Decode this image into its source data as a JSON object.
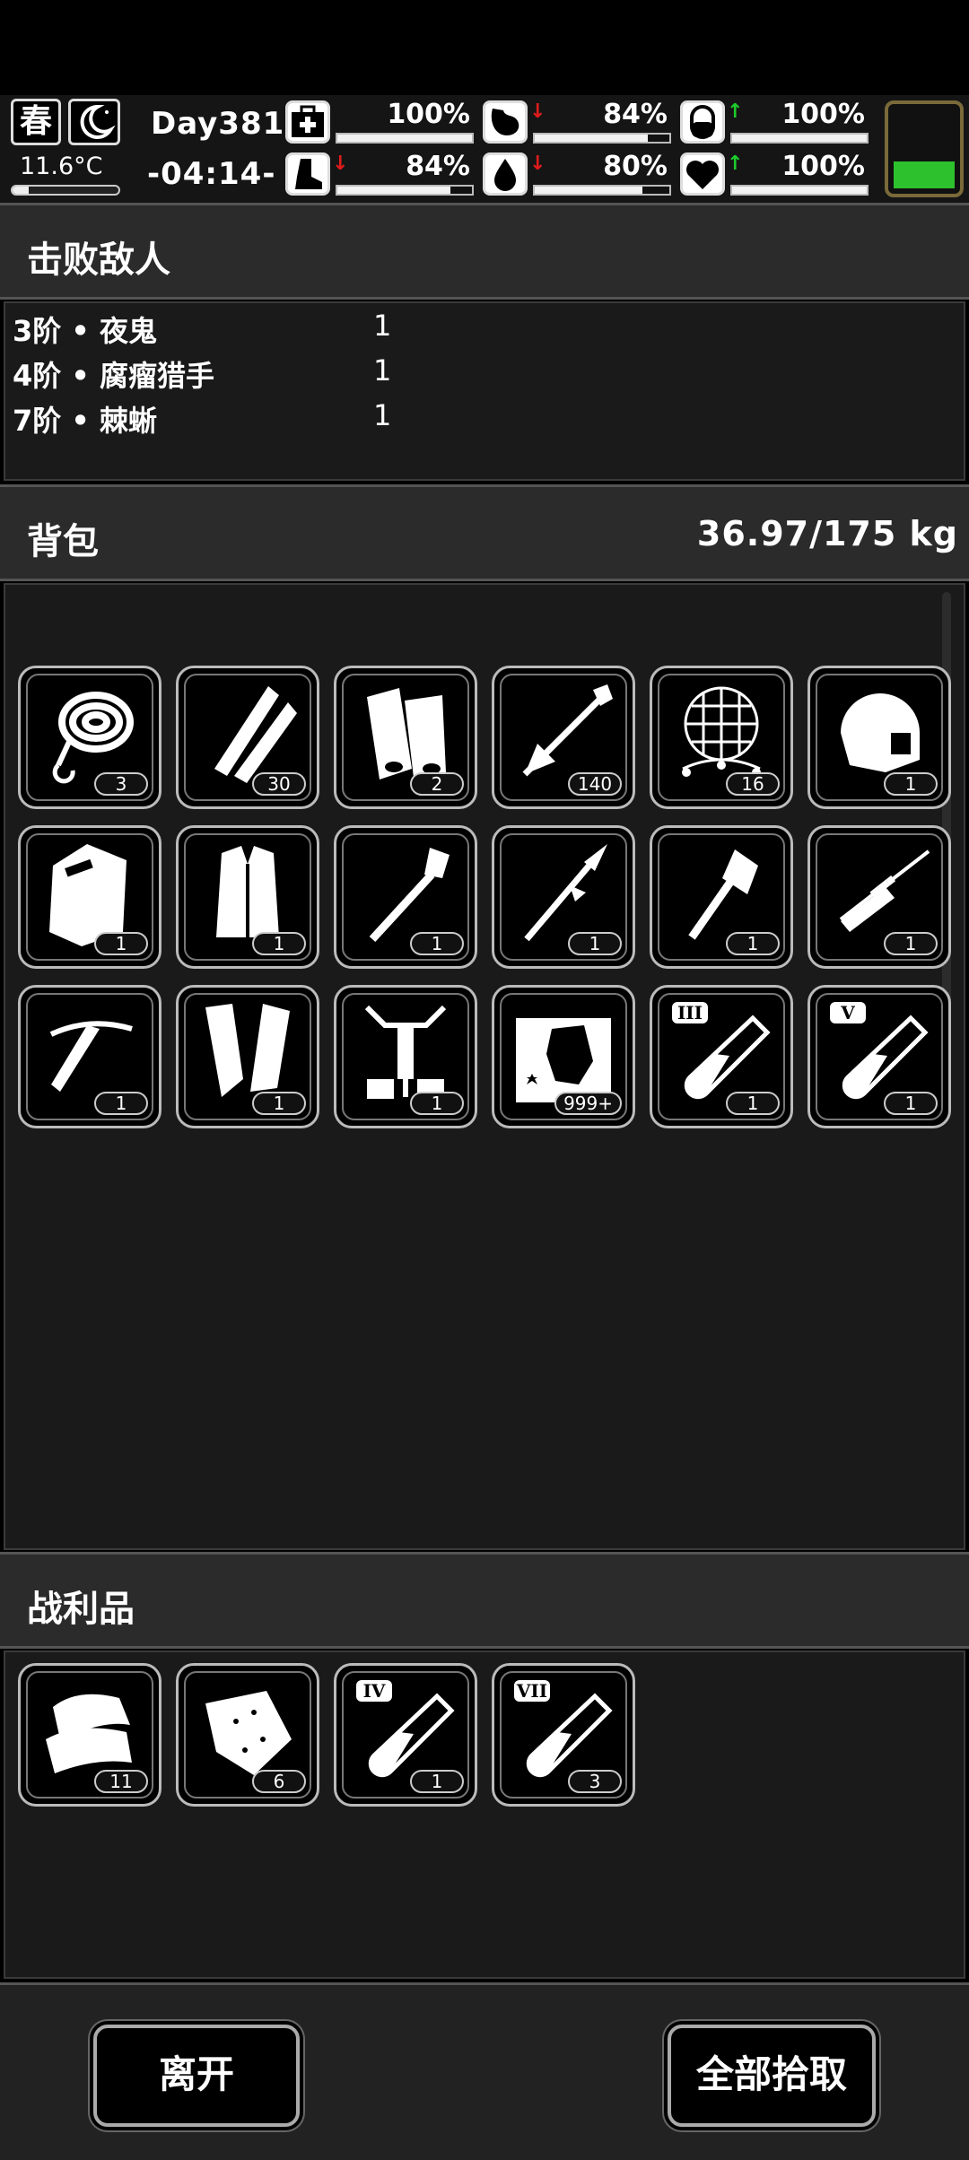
{
  "status": {
    "season": "春",
    "temperature": "11.6°C",
    "temperature_level": 0.15,
    "day": "Day381",
    "time": "-04:14-",
    "stats": [
      {
        "name": "health",
        "icon": "medkit-icon",
        "value": "100%",
        "level": 1.0,
        "trend": ""
      },
      {
        "name": "hunger",
        "icon": "stomach-icon",
        "value": "84%",
        "level": 0.84,
        "trend": "down"
      },
      {
        "name": "energy",
        "icon": "pill-icon",
        "value": "100%",
        "level": 1.0,
        "trend": "up"
      },
      {
        "name": "stamina",
        "icon": "boot-icon",
        "value": "84%",
        "level": 0.84,
        "trend": "down"
      },
      {
        "name": "thirst",
        "icon": "water-drop-icon",
        "value": "80%",
        "level": 0.8,
        "trend": "down"
      },
      {
        "name": "mood",
        "icon": "heart-icon",
        "value": "100%",
        "level": 1.0,
        "trend": "up"
      }
    ],
    "battery_level": 0.3
  },
  "defeated": {
    "title": "击败敌人",
    "enemies": [
      {
        "name": "3阶 • 夜鬼",
        "count": "1"
      },
      {
        "name": "4阶 • 腐瘤猎手",
        "count": "1"
      },
      {
        "name": "7阶 • 棘蜥",
        "count": "1"
      }
    ]
  },
  "backpack": {
    "title": "背包",
    "weight": "36.97/175 kg",
    "items": [
      {
        "icon": "rope-icon",
        "qty": "3"
      },
      {
        "icon": "bullets-icon",
        "qty": "30"
      },
      {
        "icon": "cloth-roll-icon",
        "qty": "2"
      },
      {
        "icon": "arrow-icon",
        "qty": "140"
      },
      {
        "icon": "net-icon",
        "qty": "16"
      },
      {
        "icon": "helmet-icon",
        "qty": "1"
      },
      {
        "icon": "riot-shield-icon",
        "qty": "1"
      },
      {
        "icon": "fur-coat-icon",
        "qty": "1"
      },
      {
        "icon": "shovel-icon",
        "qty": "1"
      },
      {
        "icon": "spear-icon",
        "qty": "1"
      },
      {
        "icon": "axe-icon",
        "qty": "1"
      },
      {
        "icon": "sniper-rifle-icon",
        "qty": "1"
      },
      {
        "icon": "crossbow-icon",
        "qty": "1"
      },
      {
        "icon": "arm-guards-icon",
        "qty": "1"
      },
      {
        "icon": "exoskeleton-icon",
        "qty": "1"
      },
      {
        "icon": "monster-card-icon",
        "qty": "999+"
      },
      {
        "icon": "test-tube-icon",
        "tier": "III",
        "qty": "1"
      },
      {
        "icon": "test-tube-icon",
        "tier": "V",
        "qty": "1"
      }
    ]
  },
  "loot": {
    "title": "战利品",
    "items": [
      {
        "icon": "leather-icon",
        "qty": "11"
      },
      {
        "icon": "raw-meat-icon",
        "qty": "6"
      },
      {
        "icon": "test-tube-icon",
        "tier": "IV",
        "qty": "1"
      },
      {
        "icon": "test-tube-icon",
        "tier": "VII",
        "qty": "3"
      }
    ]
  },
  "actions": {
    "leave": "离开",
    "pickup_all": "全部拾取"
  }
}
